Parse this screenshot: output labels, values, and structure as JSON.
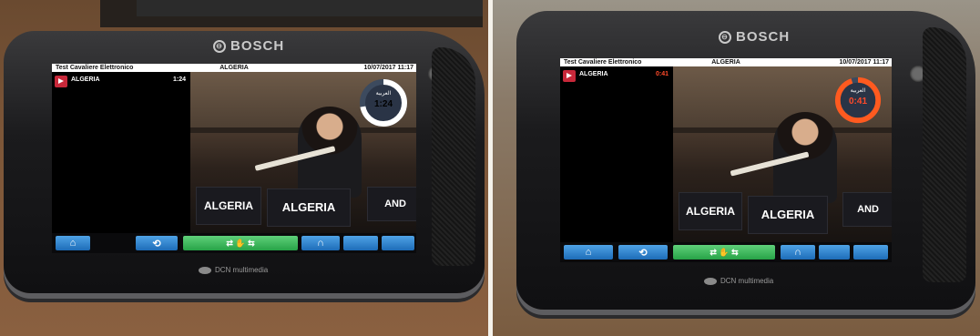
{
  "brand": "BOSCH",
  "product": "DCN multimedia",
  "panels": [
    {
      "title": "Test Cavaliere Elettronico",
      "channel": "ALGERIA",
      "datetime": "10/07/2017 11:17",
      "speaker_name": "ALGERIA",
      "speaker_time": "1:24",
      "timer_time": "1:24",
      "timer_lang": "العربية",
      "timer_fraction": 0.72,
      "time_color": "#ffffff",
      "ring_color": "#ffffff",
      "nameplates": [
        "ALGERIA",
        "ALGERIA",
        "AND"
      ]
    },
    {
      "title": "Test Cavaliere Elettronico",
      "channel": "ALGERIA",
      "datetime": "10/07/2017 11:17",
      "speaker_name": "ALGERIA",
      "speaker_time": "0:41",
      "timer_time": "0:41",
      "timer_lang": "العربية",
      "timer_fraction": 0.95,
      "time_color": "#ff4a2a",
      "ring_color": "#ff5a1f",
      "nameplates": [
        "ALGERIA",
        "ALGERIA",
        "AND"
      ]
    }
  ],
  "buttons": [
    {
      "name": "home-button",
      "glyph": "⌂"
    },
    {
      "name": "back-button",
      "glyph": "⟲"
    },
    {
      "name": "swap-channel-button",
      "glyph": "⇄ ✋ ⇆"
    },
    {
      "name": "headphones-button",
      "glyph": "∩"
    },
    {
      "name": "blank-button-1",
      "glyph": ""
    },
    {
      "name": "blank-button-2",
      "glyph": ""
    }
  ],
  "colors": {
    "button_blue": "#2f86d6",
    "button_green": "#3cbc5c",
    "speaker_red": "#c8283a"
  }
}
